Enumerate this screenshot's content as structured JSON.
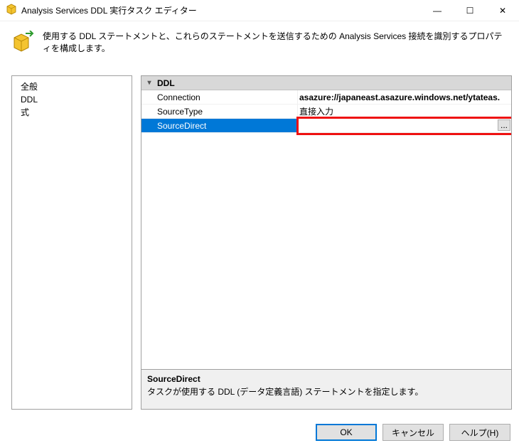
{
  "titlebar": {
    "title": "Analysis Services DDL 実行タスク エディター"
  },
  "header": {
    "description": "使用する DDL ステートメントと、これらのステートメントを送信するための Analysis Services 接続を識別するプロパティを構成します。"
  },
  "nav": {
    "items": [
      {
        "label": "全般"
      },
      {
        "label": "DDL"
      },
      {
        "label": "式"
      }
    ],
    "selected_index": 1
  },
  "grid": {
    "category": "DDL",
    "rows": [
      {
        "label": "Connection",
        "value": "asazure://japaneast.asazure.windows.net/ytateas."
      },
      {
        "label": "SourceType",
        "value": "直接入力"
      },
      {
        "label": "SourceDirect",
        "value": ""
      }
    ],
    "selected_index": 2
  },
  "description_pane": {
    "title": "SourceDirect",
    "text": "タスクが使用する DDL (データ定義言語) ステートメントを指定します。"
  },
  "footer": {
    "ok": "OK",
    "cancel": "キャンセル",
    "help": "ヘルプ(H)"
  },
  "icons": {
    "ellipsis": "...",
    "min": "—",
    "max": "☐",
    "close": "✕"
  }
}
